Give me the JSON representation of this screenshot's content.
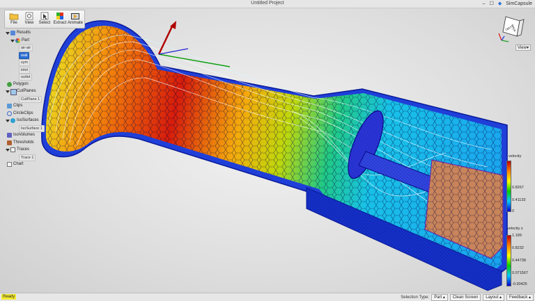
{
  "window": {
    "title": "Untitled Project",
    "app_name": "SimCapsule"
  },
  "toolbar": {
    "buttons": [
      {
        "label": "File",
        "icon": "folder-icon"
      },
      {
        "label": "View",
        "icon": "view-icon"
      },
      {
        "label": "Select",
        "icon": "select-icon"
      },
      {
        "label": "Extract",
        "icon": "extract-icon"
      },
      {
        "label": "Animate",
        "icon": "animate-icon"
      }
    ]
  },
  "tree": {
    "root": "Results",
    "part": "Part",
    "part_children": [
      "air-air",
      "wall",
      "sym",
      "inlet",
      "outlet"
    ],
    "selected": "wall",
    "polygon": "Polygon",
    "cutplanes": "CutPlanes",
    "cutplane_1": "CutPlane 1",
    "clips": "Clips",
    "circleclips": "CircleClips",
    "isosurfaces": "IsoSurfaces",
    "isosurface_1": "IsoSurface 1",
    "isovolumes": "IsoVolumes",
    "thresholds": "Thresholds",
    "traces": "Traces",
    "trace_1": "Trace 1",
    "chart": "Chart"
  },
  "view": {
    "dropdown_label": "View",
    "cube_faces": [
      "BACK",
      "LEFT",
      "TOP"
    ]
  },
  "legend_velocity": {
    "title": "velocity",
    "ticks": [
      "0.8267",
      "0.41133",
      "0"
    ],
    "colors": [
      "#c00000",
      "#ff8000",
      "#ffff00",
      "#00d000",
      "#00c8ff",
      "#0000d0"
    ]
  },
  "legend_velocity_z": {
    "title": "velocity z",
    "ticks": [
      "1.199",
      "0.8232",
      "0.44738",
      "0.071567",
      "-0.30425"
    ],
    "colors": [
      "#c00000",
      "#ff8000",
      "#ffff00",
      "#00d000",
      "#00c8ff",
      "#0000d0"
    ]
  },
  "statusbar": {
    "left_text": "Ready",
    "selection_type_label": "Selection Type:",
    "selection_type_value": "Part",
    "clean_screen": "Clean Screen",
    "layout": "Layout",
    "feedback": "Feedback"
  }
}
